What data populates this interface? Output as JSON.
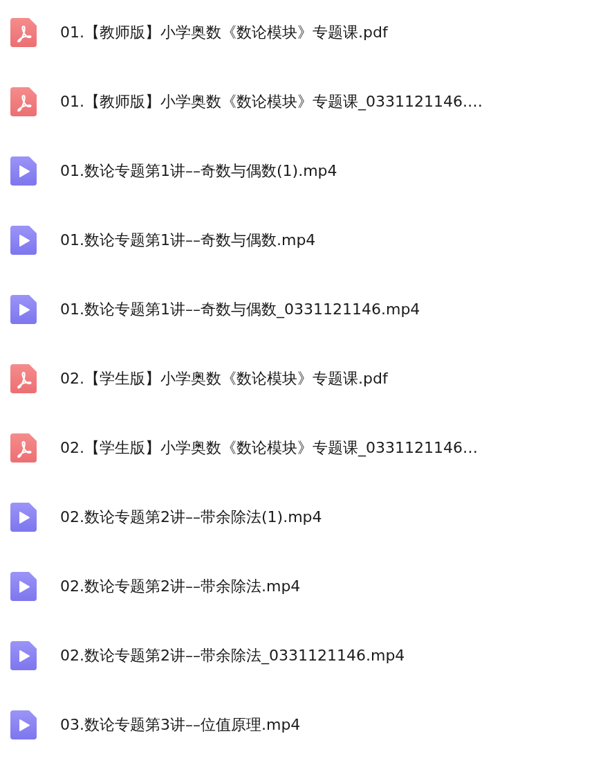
{
  "files": [
    {
      "kind": "pdf",
      "name": "01.【教师版】小学奥数《数论模块》专题课.pdf"
    },
    {
      "kind": "pdf",
      "name": "01.【教师版】小学奥数《数论模块》专题课_0331121146.…"
    },
    {
      "kind": "video",
      "name": "01.数论专题第1讲––奇数与偶数(1).mp4"
    },
    {
      "kind": "video",
      "name": "01.数论专题第1讲––奇数与偶数.mp4"
    },
    {
      "kind": "video",
      "name": "01.数论专题第1讲––奇数与偶数_0331121146.mp4"
    },
    {
      "kind": "pdf",
      "name": "02.【学生版】小学奥数《数论模块》专题课.pdf"
    },
    {
      "kind": "pdf",
      "name": "02.【学生版】小学奥数《数论模块》专题课_0331121146…"
    },
    {
      "kind": "video",
      "name": "02.数论专题第2讲––带余除法(1).mp4"
    },
    {
      "kind": "video",
      "name": "02.数论专题第2讲––带余除法.mp4"
    },
    {
      "kind": "video",
      "name": "02.数论专题第2讲––带余除法_0331121146.mp4"
    },
    {
      "kind": "video",
      "name": "03.数论专题第3讲––位值原理.mp4"
    }
  ]
}
